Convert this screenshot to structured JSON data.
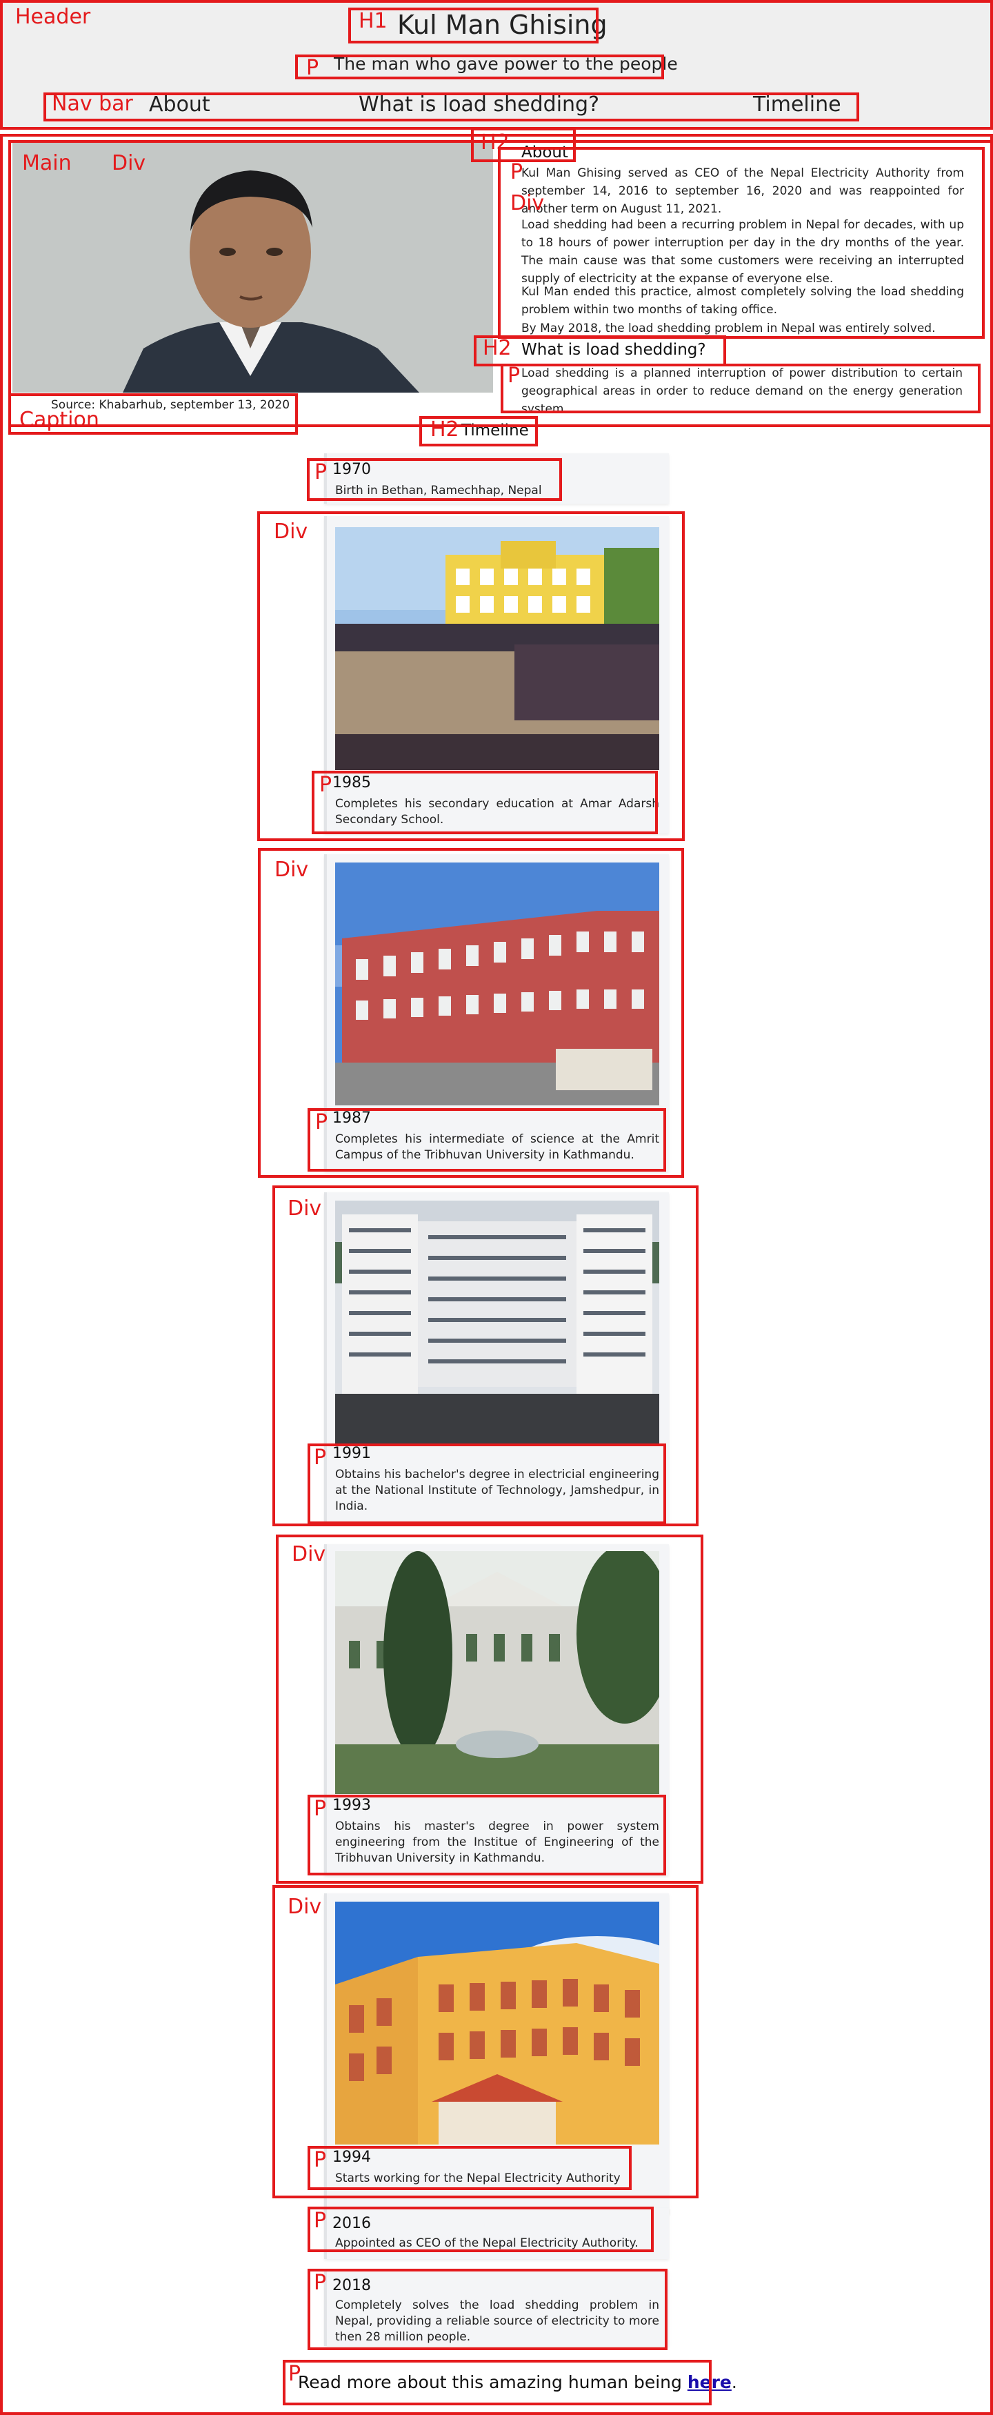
{
  "annotations": {
    "header": "Header",
    "h1": "H1",
    "p": "P",
    "nav_bar": "Nav bar",
    "h2": "H2",
    "main": "Main",
    "div": "Div",
    "caption": "Caption"
  },
  "header": {
    "title": "Kul Man Ghising",
    "tagline": "The man who gave power to the people",
    "nav": [
      "About",
      "What is load shedding?",
      "Timeline"
    ]
  },
  "main": {
    "photo_caption": "Source: Khabarhub, september 13, 2020",
    "about": {
      "title": "About",
      "paragraphs": [
        "Kul Man Ghising served as CEO of the Nepal Electricity Authority from september 14, 2016 to september 16, 2020 and was reappointed for another term on August 11, 2021.",
        "Load shedding had been a recurring problem in Nepal for decades, with up to 18 hours of power interruption per day in the dry months of the year. The main cause was that some customers were receiving an interrupted supply of electricity at the expanse of everyone else.",
        "Kul Man ended this practice, almost completely solving the load shedding problem within two months of taking office.",
        "By May 2018, the load shedding problem in Nepal was entirely solved."
      ]
    },
    "load_shedding": {
      "title": "What is load shedding?",
      "text": "Load shedding is a planned interruption of power distribution to certain geographical areas in order to reduce demand on the energy generation system."
    }
  },
  "timeline": {
    "title": "Timeline",
    "events": [
      {
        "year": "1970",
        "text": "Birth in Bethan, Ramechhap, Nepal"
      },
      {
        "year": "1985",
        "text": "Completes his secondary education at Amar Adarsh Secondary School."
      },
      {
        "year": "1987",
        "text": "Completes his intermediate of science at the Amrit Campus of the Tribhuvan University in Kathmandu."
      },
      {
        "year": "1991",
        "text": "Obtains his bachelor's degree in electricial engineering at the National Institute of Technology, Jamshedpur, in India."
      },
      {
        "year": "1993",
        "text": "Obtains his master's degree in power system engineering from the Institue of Engineering of the Tribhuvan University in Kathmandu."
      },
      {
        "year": "1994",
        "text": "Starts working for the Nepal Electricity Authority"
      },
      {
        "year": "2016",
        "text": "Appointed as CEO of the Nepal Electricity Authority."
      },
      {
        "year": "2018",
        "text": "Completely solves the load shedding problem in Nepal, providing a reliable source of electricity to more then 28 million people."
      }
    ]
  },
  "footer": {
    "text": "Read more about this amazing human being ",
    "link": "here",
    "end": "."
  }
}
